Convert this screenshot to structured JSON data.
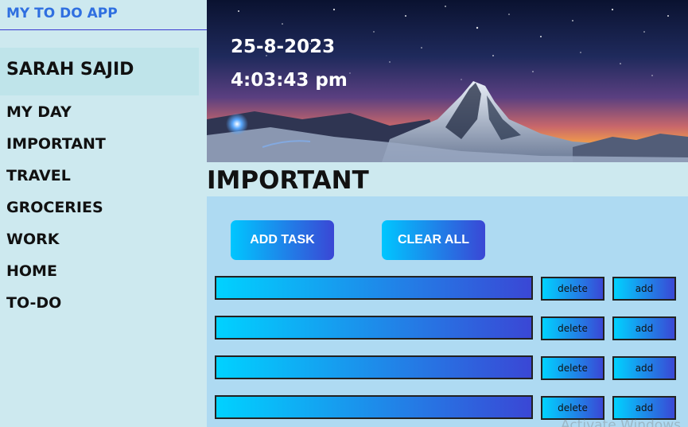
{
  "app": {
    "title": "MY TO DO APP",
    "user_name": "SARAH SAJID"
  },
  "sidebar": {
    "items": [
      {
        "label": "MY DAY"
      },
      {
        "label": "IMPORTANT"
      },
      {
        "label": "TRAVEL"
      },
      {
        "label": "GROCERIES"
      },
      {
        "label": "WORK"
      },
      {
        "label": "HOME"
      },
      {
        "label": "TO-DO"
      }
    ]
  },
  "hero": {
    "date": "25-8-2023",
    "time": "4:03:43 pm"
  },
  "section": {
    "title": "IMPORTANT"
  },
  "actions": {
    "add_task_label": "ADD TASK",
    "clear_all_label": "CLEAR ALL"
  },
  "tasks": [
    {
      "value": "",
      "delete_label": "delete",
      "add_label": "add"
    },
    {
      "value": "",
      "delete_label": "delete",
      "add_label": "add"
    },
    {
      "value": "",
      "delete_label": "delete",
      "add_label": "add"
    },
    {
      "value": "",
      "delete_label": "delete",
      "add_label": "add"
    }
  ],
  "watermark": "Activate Windows",
  "colors": {
    "background": "#cde9ef",
    "panel": "#aedaf2",
    "accent_title": "#2f6fe0",
    "gradient_start": "#00c6ff",
    "gradient_end": "#3a47d5"
  }
}
